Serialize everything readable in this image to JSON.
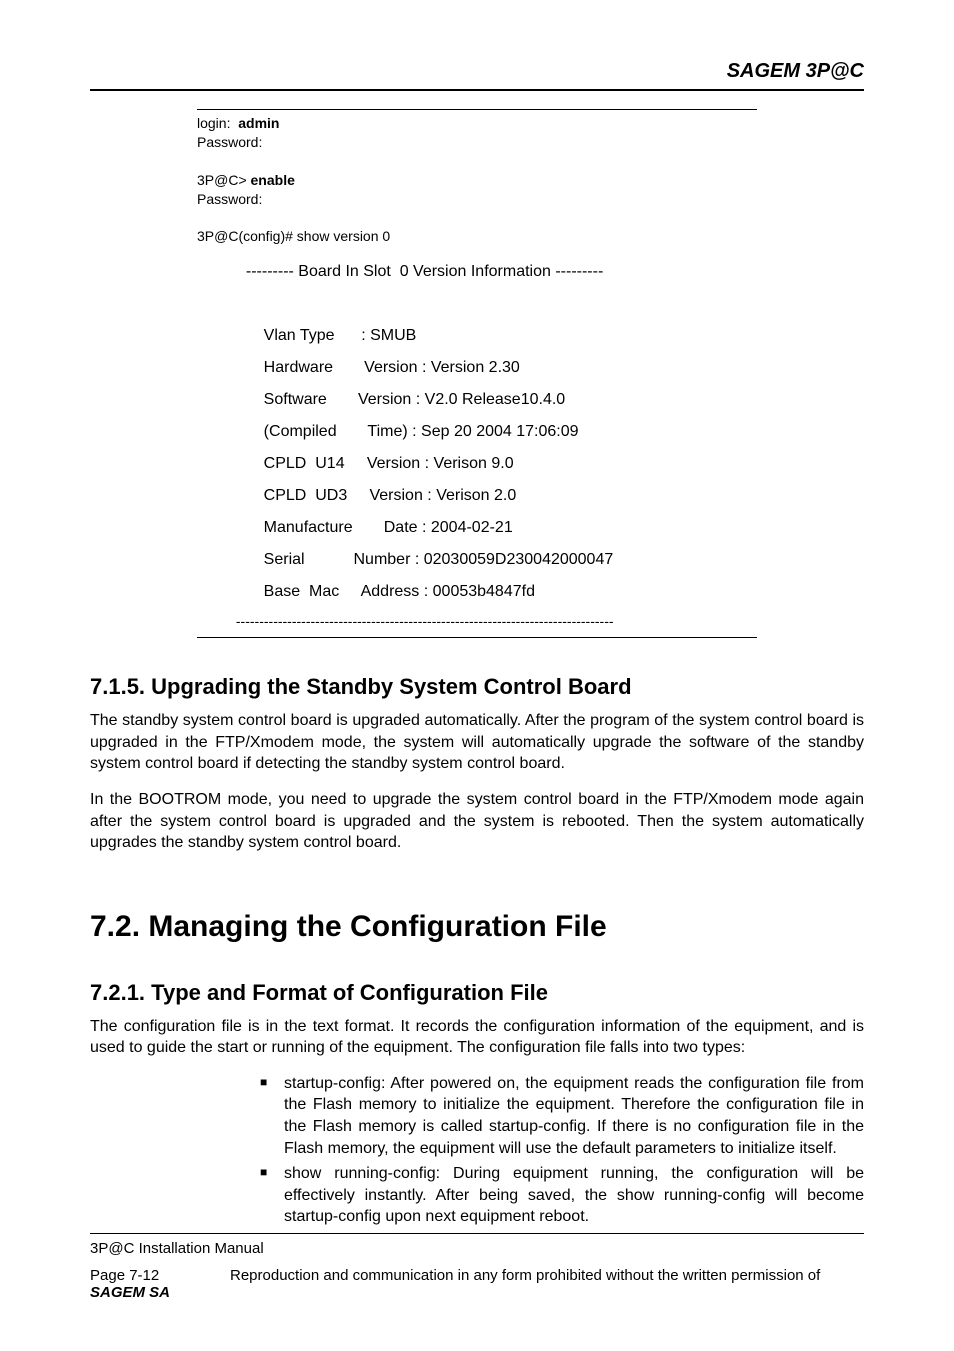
{
  "header": {
    "brand": "SAGEM 3P@C"
  },
  "terminal": {
    "login_label": "login:  ",
    "login_value": "admin",
    "password1": "Password:",
    "prompt_enable_prefix": "3P@C> ",
    "prompt_enable_cmd": "enable",
    "password2": "Password:",
    "show_version_cmd": "3P@C(config)# show version 0",
    "board_header": "           --------- Board In Slot  0 Version Information ---------",
    "rows": [
      "               Vlan Type      : SMUB",
      "               Hardware       Version : Version 2.30",
      "               Software       Version : V2.0 Release10.4.0",
      "               (Compiled       Time) : Sep 20 2004 17:06:09",
      "               CPLD  U14     Version : Verison 9.0",
      "               CPLD  UD3     Version : Verison 2.0",
      "               Manufacture       Date : 2004-02-21",
      "               Serial           Number : 02030059D230042000047",
      "               Base  Mac     Address : 00053b4847fd"
    ],
    "dash_footer": "          ---------------------------------------------------------------------------------"
  },
  "sections": {
    "upgrade": {
      "heading": "7.1.5. Upgrading the Standby System Control Board",
      "p1": "The standby system control board is upgraded automatically. After the program of the system control board is upgraded in the FTP/Xmodem mode, the system will automatically upgrade the software of the standby system control board if detecting the standby system control board.",
      "p2": "In the BOOTROM mode, you need to upgrade the system control board in the FTP/Xmodem mode again after the system control board is upgraded and the system is rebooted. Then the system automatically upgrades the standby system control board."
    },
    "managing": {
      "heading": "7.2. Managing the Configuration File"
    },
    "typeformat": {
      "heading": "7.2.1. Type and Format of Configuration File",
      "p1": "The configuration file is in the text format. It records the configuration information of the equipment, and is used to guide the start or running of the equipment. The configuration file falls into two types:",
      "bullets": [
        "startup-config: After powered on, the equipment reads the configuration file from the Flash memory to initialize the equipment. Therefore the configuration file in the Flash memory is called startup-config. If there is no configuration file in the Flash memory, the equipment will use the default parameters to initialize itself.",
        "show running-config: During equipment running, the configuration will be effectively instantly. After being saved, the show running-config will become startup-config upon next equipment reboot."
      ]
    }
  },
  "footer": {
    "manual": "3P@C Installation Manual",
    "page": "Page 7-12",
    "brand": "SAGEM SA",
    "rights": "Reproduction and communication in any form prohibited without the written permission of"
  }
}
